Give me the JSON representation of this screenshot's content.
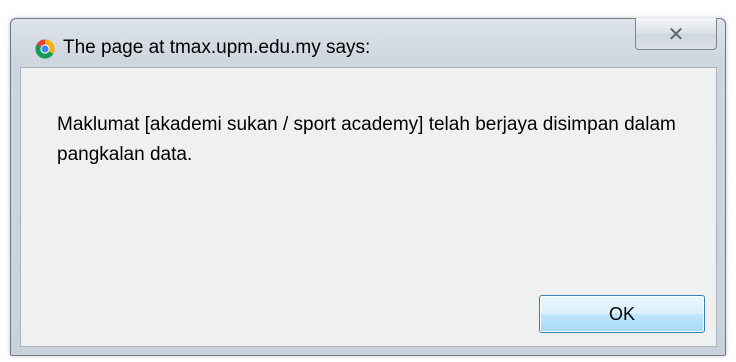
{
  "dialog": {
    "title": "The page at tmax.upm.edu.my says:",
    "close_icon": "close-icon",
    "message": "Maklumat [akademi sukan / sport academy] telah berjaya disimpan dalam pangkalan data.",
    "ok_label": "OK"
  },
  "icons": {
    "browser": "chrome-icon"
  },
  "colors": {
    "content_background": "#f0f0f0",
    "ok_border": "#3c7fb1"
  }
}
